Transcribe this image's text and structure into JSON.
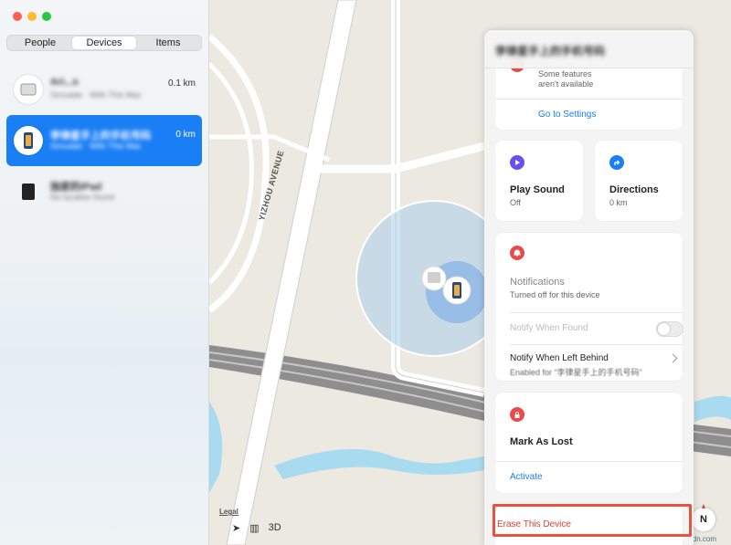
{
  "sidebar": {
    "tabs": [
      {
        "label": "People"
      },
      {
        "label": "Devices"
      },
      {
        "label": "Items"
      }
    ],
    "devices": [
      {
        "name": "Ari...s",
        "subtitle": "Simulate · With This Mac",
        "distance": "0.1 km",
        "icon": "ipad-icon"
      },
      {
        "name": "李律星手上的手机号码",
        "subtitle": "Simulate · With This Mac",
        "distance": "0 km",
        "icon": "iphone-icon"
      },
      {
        "name": "独家的iPad",
        "subtitle": "No location found",
        "distance": "",
        "icon": "ipad-icon"
      }
    ]
  },
  "map": {
    "street_label": "YIZHOU AVENUE",
    "legal": "Legal",
    "view_3d": "3D",
    "compass": "N",
    "watermark": "wsxdn.com"
  },
  "panel": {
    "title": "李律星手上的手机号码",
    "features": {
      "caption_line1": "Some features",
      "caption_line2": "aren't available",
      "link": "Go to Settings"
    },
    "play_sound": {
      "title": "Play Sound",
      "status": "Off"
    },
    "directions": {
      "title": "Directions",
      "distance": "0 km"
    },
    "notifications": {
      "title": "Notifications",
      "status": "Turned off for this device",
      "notify_found": "Notify When Found",
      "notify_left": "Notify When Left Behind",
      "notify_left_sub": "Enabled for “李律星手上的手机号码”"
    },
    "lost": {
      "title": "Mark As Lost",
      "link": "Activate"
    },
    "erase": {
      "label": "Erase This Device"
    }
  },
  "colors": {
    "accent": "#1a7ef5",
    "destructive": "#e8533f",
    "play": "#6a4ff0",
    "alert": "#ea4a4a"
  }
}
